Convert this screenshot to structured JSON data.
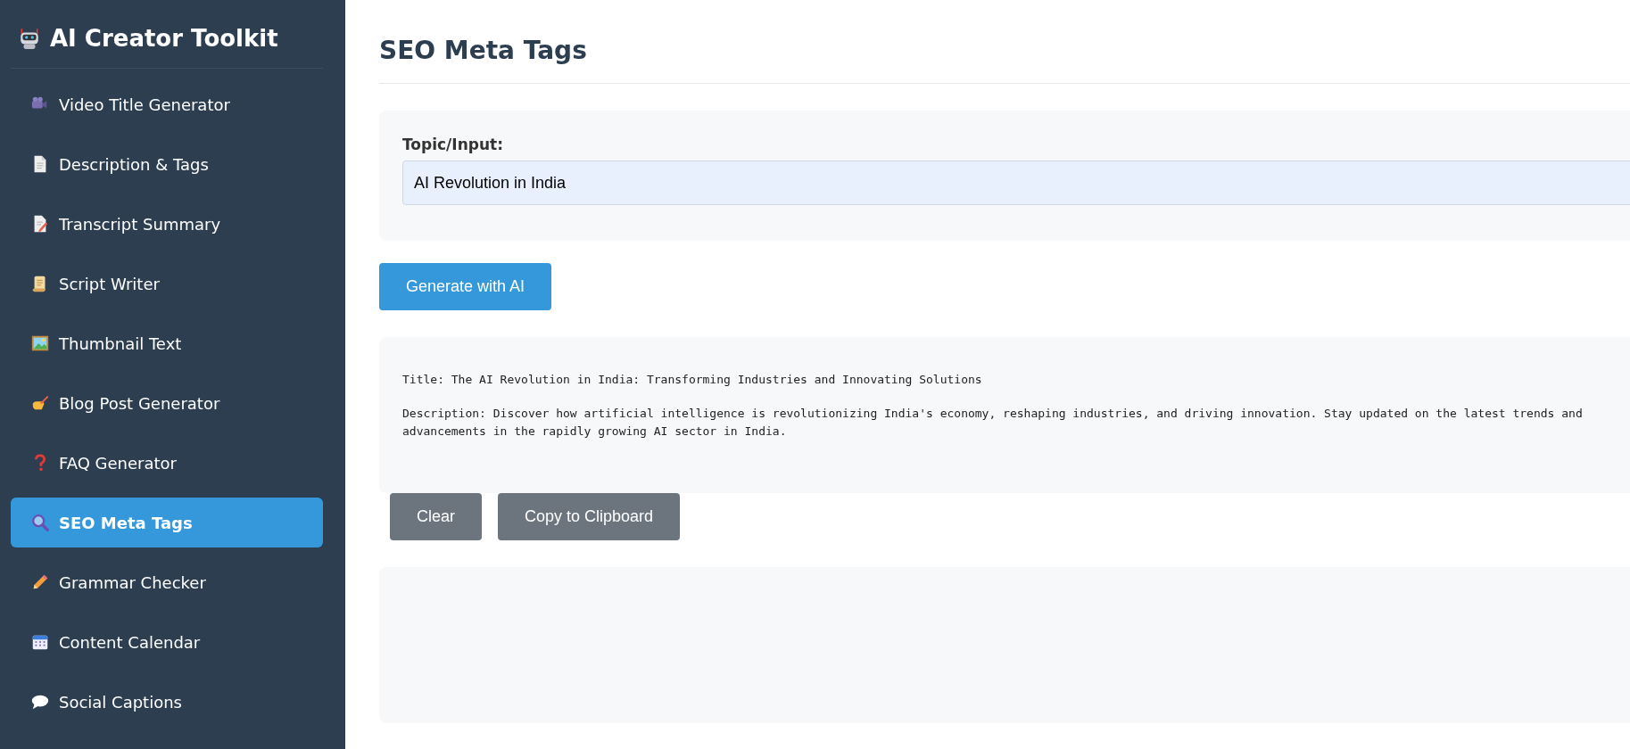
{
  "sidebar": {
    "title": "AI Creator Toolkit",
    "items": [
      {
        "label": "Video Title Generator",
        "selected": false
      },
      {
        "label": "Description & Tags",
        "selected": false
      },
      {
        "label": "Transcript Summary",
        "selected": false
      },
      {
        "label": "Script Writer",
        "selected": false
      },
      {
        "label": "Thumbnail Text",
        "selected": false
      },
      {
        "label": "Blog Post Generator",
        "selected": false
      },
      {
        "label": "FAQ Generator",
        "selected": false
      },
      {
        "label": "SEO Meta Tags",
        "selected": true
      },
      {
        "label": "Grammar Checker",
        "selected": false
      },
      {
        "label": "Content Calendar",
        "selected": false
      },
      {
        "label": "Social Captions",
        "selected": false
      }
    ]
  },
  "main": {
    "heading": "SEO Meta Tags",
    "input": {
      "label": "Topic/Input:",
      "value": "AI Revolution in India"
    },
    "generate_button": "Generate with AI",
    "output": [
      "Title: The AI Revolution in India: Transforming Industries and Innovating Solutions",
      "Description: Discover how artificial intelligence is revolutionizing India's economy, reshaping industries, and driving innovation. Stay updated on the latest trends and advancements in the rapidly growing AI sector in India."
    ],
    "buttons": [
      "Clear",
      "Copy to Clipboard"
    ]
  }
}
